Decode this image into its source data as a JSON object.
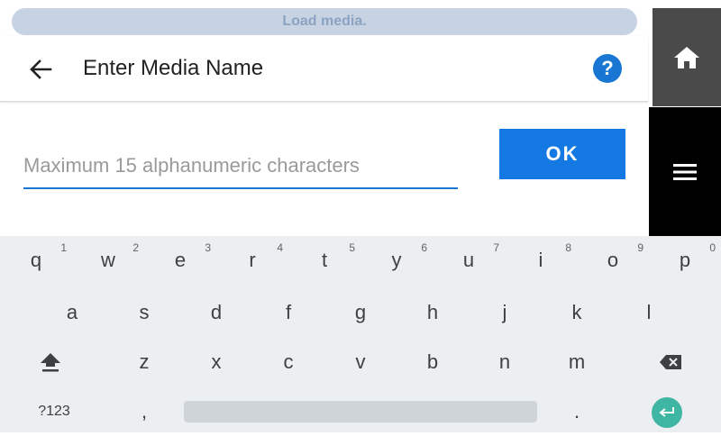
{
  "banner": {
    "text": "Load media."
  },
  "header": {
    "title": "Enter Media Name",
    "help_label": "?"
  },
  "input": {
    "placeholder": "Maximum 15 alphanumeric characters",
    "value": ""
  },
  "ok_button": {
    "label": "OK"
  },
  "keyboard": {
    "row1": [
      {
        "k": "q",
        "h": "1"
      },
      {
        "k": "w",
        "h": "2"
      },
      {
        "k": "e",
        "h": "3"
      },
      {
        "k": "r",
        "h": "4"
      },
      {
        "k": "t",
        "h": "5"
      },
      {
        "k": "y",
        "h": "6"
      },
      {
        "k": "u",
        "h": "7"
      },
      {
        "k": "i",
        "h": "8"
      },
      {
        "k": "o",
        "h": "9"
      },
      {
        "k": "p",
        "h": "0"
      }
    ],
    "row2": [
      "a",
      "s",
      "d",
      "f",
      "g",
      "h",
      "j",
      "k",
      "l"
    ],
    "row3": [
      "z",
      "x",
      "c",
      "v",
      "b",
      "n",
      "m"
    ],
    "symbols_label": "?123",
    "comma": ",",
    "period": "."
  },
  "colors": {
    "accent": "#1976d2",
    "ok": "#1479e3",
    "enter": "#3fb5a3",
    "side_home": "#4a4a4a",
    "side_menu": "#000000"
  },
  "icons": {
    "back": "arrow-left-icon",
    "help": "help-icon",
    "home": "home-icon",
    "menu": "menu-icon",
    "shift": "shift-icon",
    "backspace": "backspace-icon",
    "enter": "enter-icon"
  }
}
